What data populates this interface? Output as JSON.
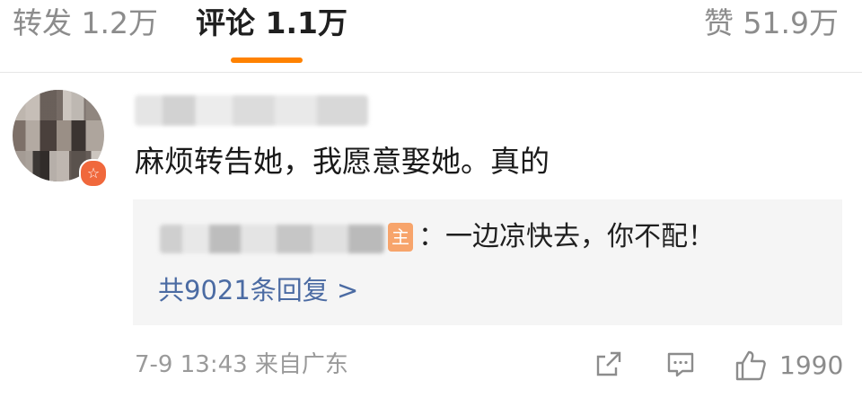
{
  "tabs": {
    "repost": "转发 1.2万",
    "comment": "评论 1.1万",
    "like": "赞 51.9万",
    "active": "comment",
    "accent_color": "#ff8200"
  },
  "comment": {
    "avatar_badge_icon": "weibo-verified-icon",
    "text": "麻烦转告她，我愿意娶她。真的",
    "reply": {
      "author_badge": "主",
      "text": "：一边凉快去，你不配！",
      "more_label": "共9021条回复 >"
    },
    "meta": "7-9 13:43  来自广东",
    "actions": {
      "share_icon": "share-icon",
      "comment_icon": "comment-icon",
      "like_icon": "thumbs-up-icon",
      "like_count": "1990"
    }
  }
}
